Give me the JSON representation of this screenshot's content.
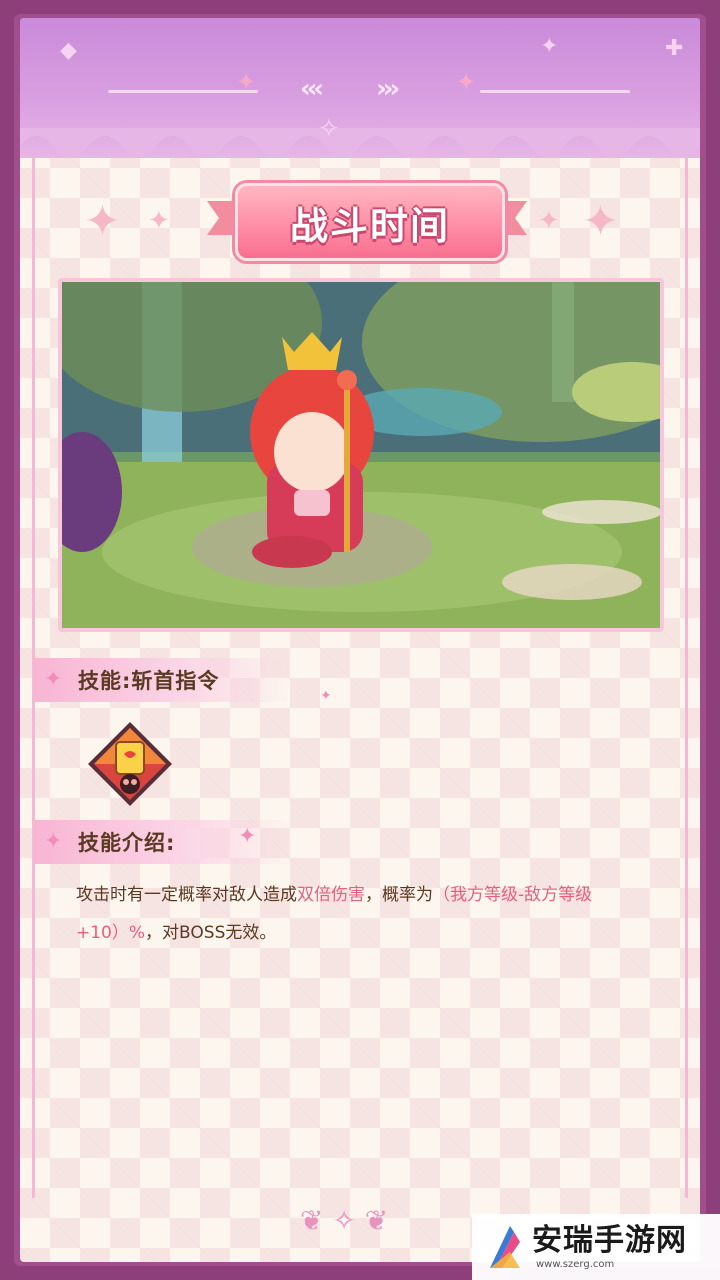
{
  "header": {
    "title": "战斗时间"
  },
  "battle_screenshot": {
    "description_icon": "battle-scene-image"
  },
  "skill": {
    "section_label": "技能:斩首指令",
    "icon": "skill-card-icon"
  },
  "skill_intro": {
    "section_label": "技能介绍:",
    "text_part1": "攻击时有一定概率对敌人造成",
    "text_highlight1": "双倍伤害",
    "text_part2": "，概率为",
    "text_highlight2": "（我方等级-敌方等级+10）%",
    "text_part3": "，对BOSS无效。"
  },
  "watermark": {
    "title": "安瑞手游网",
    "url": "www.szerg.com"
  },
  "colors": {
    "outer_frame": "#8c3f78",
    "header_purple": "#c98ad9",
    "title_pink": "#ff8aa4",
    "highlight_red": "#e85f7c",
    "body_text": "#5a3a22"
  }
}
